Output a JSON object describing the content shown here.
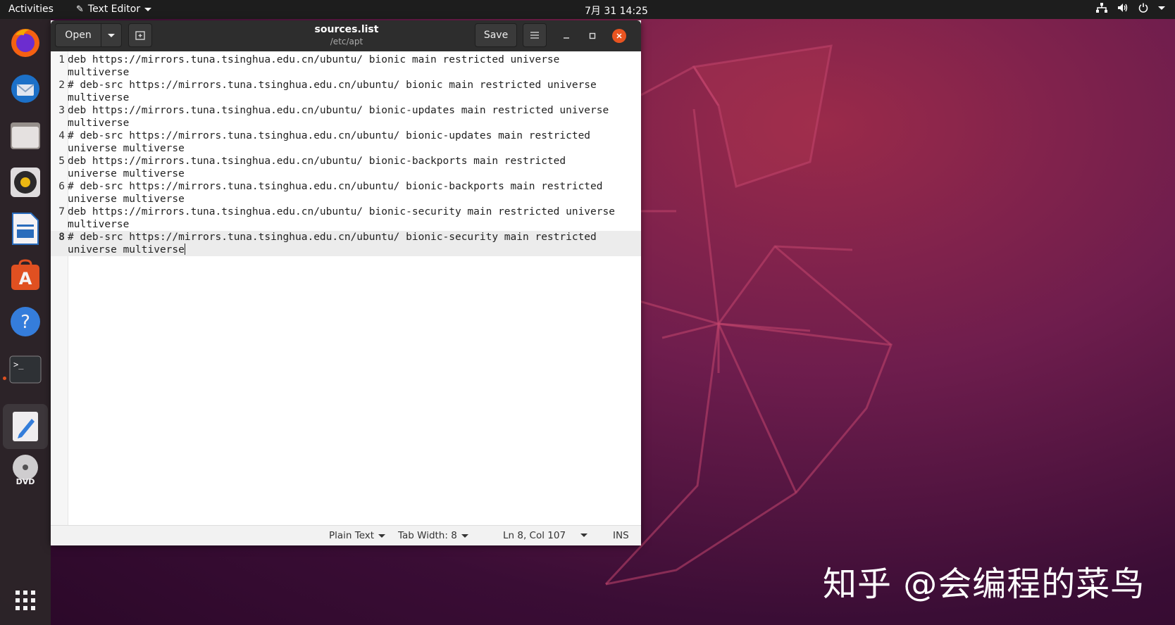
{
  "topbar": {
    "activities": "Activities",
    "app_menu": "Text Editor",
    "clock": "7月 31  14:25",
    "tray": {
      "network": "network-icon",
      "volume": "volume-icon",
      "power": "power-icon"
    }
  },
  "dock": {
    "items": [
      "firefox-icon",
      "thunderbird-icon",
      "files-icon",
      "rhythmbox-icon",
      "libreoffice-writer-icon",
      "software-center-icon",
      "help-icon",
      "terminal-icon",
      "text-editor-icon",
      "dvd-icon",
      "show-apps-icon"
    ]
  },
  "window": {
    "open_label": "Open",
    "save_label": "Save",
    "title": "sources.list",
    "subtitle": "/etc/apt"
  },
  "editor": {
    "lines": [
      {
        "n": "1",
        "text": "deb https://mirrors.tuna.tsinghua.edu.cn/ubuntu/ bionic main restricted universe\nmultiverse"
      },
      {
        "n": "2",
        "text": "# deb-src https://mirrors.tuna.tsinghua.edu.cn/ubuntu/ bionic main restricted universe\nmultiverse"
      },
      {
        "n": "3",
        "text": "deb https://mirrors.tuna.tsinghua.edu.cn/ubuntu/ bionic-updates main restricted universe\nmultiverse"
      },
      {
        "n": "4",
        "text": "# deb-src https://mirrors.tuna.tsinghua.edu.cn/ubuntu/ bionic-updates main restricted\nuniverse multiverse"
      },
      {
        "n": "5",
        "text": "deb https://mirrors.tuna.tsinghua.edu.cn/ubuntu/ bionic-backports main restricted\nuniverse multiverse"
      },
      {
        "n": "6",
        "text": "# deb-src https://mirrors.tuna.tsinghua.edu.cn/ubuntu/ bionic-backports main restricted\nuniverse multiverse"
      },
      {
        "n": "7",
        "text": "deb https://mirrors.tuna.tsinghua.edu.cn/ubuntu/ bionic-security main restricted universe\nmultiverse"
      },
      {
        "n": "8",
        "text": "# deb-src https://mirrors.tuna.tsinghua.edu.cn/ubuntu/ bionic-security main restricted\nuniverse multiverse"
      }
    ]
  },
  "statusbar": {
    "language": "Plain Text",
    "tab_width": "Tab Width: 8",
    "position": "Ln 8, Col 107",
    "mode": "INS"
  },
  "watermark": "知乎 @会编程的菜鸟",
  "colors": {
    "accent": "#e95420",
    "topbar": "#1d1d1d",
    "headerbar": "#2d2d2d"
  }
}
